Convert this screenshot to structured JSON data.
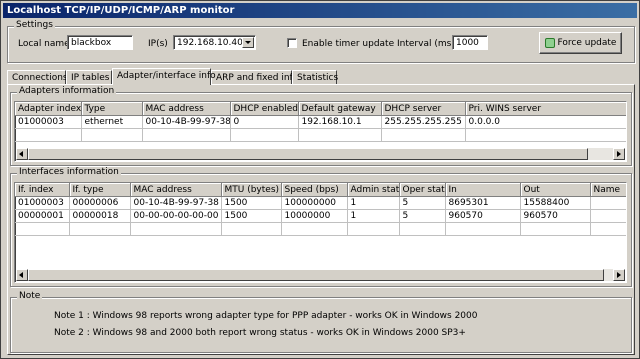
{
  "window": {
    "title": "Localhost TCP/IP/UDP/ICMP/ARP monitor"
  },
  "settings": {
    "group_label": "Settings",
    "local_name_label": "Local name",
    "local_name_value": "blackbox",
    "ips_label": "IP(s)",
    "ips_value": "192.168.10.40",
    "timer_label": "Enable timer update",
    "timer_checked": false,
    "interval_label": "Interval (ms)",
    "interval_value": "1000",
    "force_update_label": "Force update"
  },
  "tabs": [
    {
      "label": "Connections",
      "active": false
    },
    {
      "label": "IP tables",
      "active": false
    },
    {
      "label": "Adapter/interface info",
      "active": true
    },
    {
      "label": "ARP and fixed info",
      "active": false
    },
    {
      "label": "Statistics",
      "active": false
    }
  ],
  "adapters": {
    "group_label": "Adapters information",
    "columns": [
      "Adapter index",
      "Type",
      "MAC address",
      "DHCP enabled",
      "Default gateway",
      "DHCP server",
      "Pri. WINS server"
    ],
    "rows": [
      [
        "01000003",
        "ethernet",
        "00-10-4B-99-97-38",
        "0",
        "192.168.10.1",
        "255.255.255.255",
        "0.0.0.0"
      ]
    ]
  },
  "interfaces": {
    "group_label": "Interfaces information",
    "columns": [
      "If. index",
      "If. type",
      "MAC address",
      "MTU (bytes)",
      "Speed (bps)",
      "Admin stat",
      "Oper stat",
      "In",
      "Out",
      "Name"
    ],
    "rows": [
      [
        "01000003",
        "00000006",
        "00-10-4B-99-97-38",
        "1500",
        "100000000",
        "1",
        "5",
        "8695301",
        "15588400",
        ""
      ],
      [
        "00000001",
        "00000018",
        "00-00-00-00-00-00",
        "1500",
        "10000000",
        "1",
        "5",
        "960570",
        "960570",
        ""
      ]
    ]
  },
  "note": {
    "group_label": "Note",
    "lines": [
      "Note 1 : Windows 98 reports wrong adapter type for PPP adapter - works OK in Windows 2000",
      "Note 2 : Windows 98 and 2000 both report wrong status - works OK in Windows 2000 SP3+"
    ]
  }
}
